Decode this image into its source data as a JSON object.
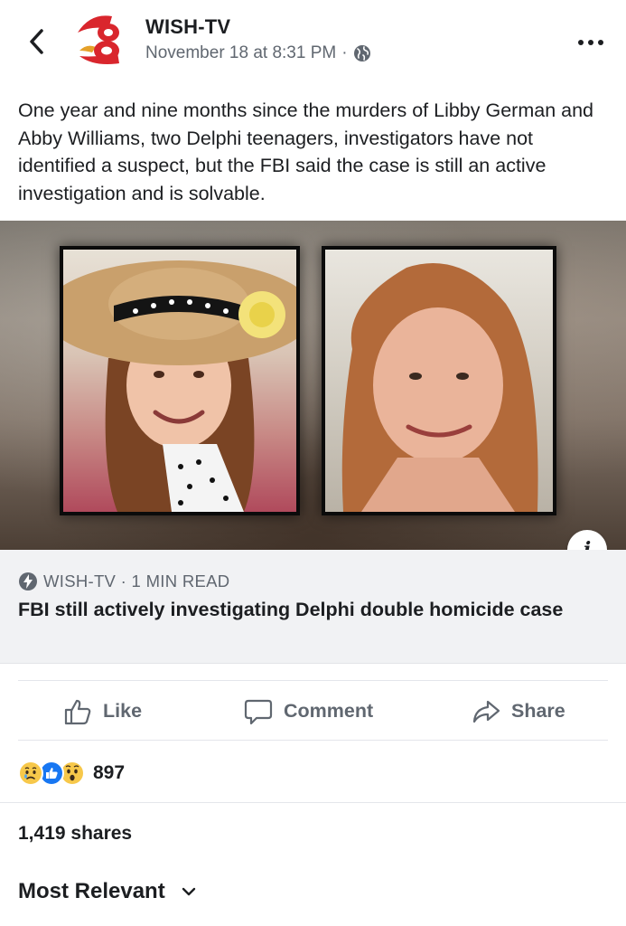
{
  "post": {
    "page_name": "WISH-TV",
    "timestamp": "November 18 at 8:31 PM",
    "separator": "·",
    "privacy_icon": "globe-icon",
    "text": "One year and nine months since the murders of Libby German and Abby Williams, two Delphi teenagers, investigators have not identified a suspect, but the FBI said the case is still an active investigation and is solvable."
  },
  "link_preview": {
    "source": "WISH-TV · 1 MIN READ",
    "title": "FBI still actively investigating Delphi double homicide case",
    "info_label": "i"
  },
  "actions": {
    "like": "Like",
    "comment": "Comment",
    "share": "Share"
  },
  "engagement": {
    "reactions": [
      "sad",
      "like",
      "wow"
    ],
    "reaction_count": "897",
    "shares": "1,419 shares"
  },
  "comments": {
    "sort_label": "Most Relevant"
  },
  "colors": {
    "secondary_text": "#606770",
    "like_blue": "#1877f2",
    "logo_red": "#d9262d",
    "link_bg": "#f1f2f4"
  }
}
